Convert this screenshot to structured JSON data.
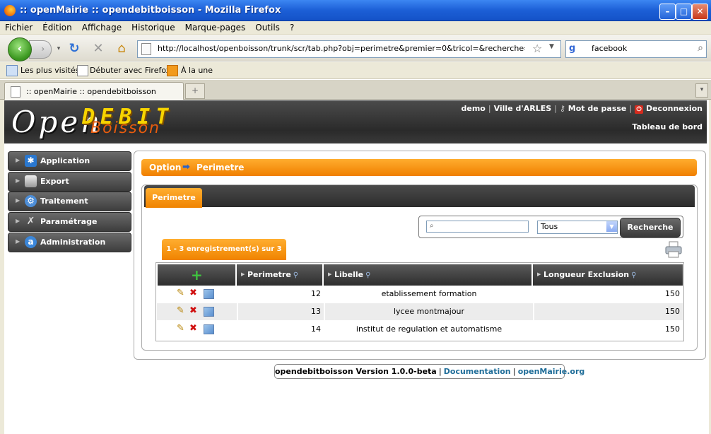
{
  "window": {
    "title": ":: openMairie :: opendebitboisson - Mozilla Firefox"
  },
  "menubar": {
    "items": [
      "Fichier",
      "Édition",
      "Affichage",
      "Historique",
      "Marque-pages",
      "Outils",
      "?"
    ]
  },
  "navbar": {
    "url": "http://localhost/openboisson/trunk/scr/tab.php?obj=perimetre&premier=0&tricol=&recherche=&selectioncol=",
    "search_value": "facebook"
  },
  "bookmarks": {
    "items": [
      "Les plus visités",
      "Débuter avec Firefox",
      "À la une"
    ]
  },
  "tabs": {
    "active_label": ":: openMairie :: opendebitboisson"
  },
  "app": {
    "logo": {
      "open": "Open",
      "debit": "DEBIT",
      "boisson": "Boisson"
    },
    "user": "demo",
    "city": "Ville d'ARLES",
    "password_link": "Mot de passe",
    "logout_link": "Deconnexion",
    "dashboard_link": "Tableau de bord"
  },
  "sidebar": {
    "items": [
      {
        "label": "Application",
        "icon": "application-icon"
      },
      {
        "label": "Export",
        "icon": "printer-icon"
      },
      {
        "label": "Traitement",
        "icon": "gear-icon"
      },
      {
        "label": "Paramétrage",
        "icon": "tools-icon"
      },
      {
        "label": "Administration",
        "icon": "admin-icon"
      }
    ]
  },
  "breadcrumb": {
    "section": "Option",
    "arrow_icon": "arrow-right-icon",
    "current": "Perimetre"
  },
  "main": {
    "tab_label": "Perimetre",
    "search": {
      "value": "",
      "scope_selected": "Tous",
      "button_label": "Recherche"
    },
    "count_label": "1 - 3 enregistrement(s) sur 3"
  },
  "table": {
    "columns": [
      "Perimetre",
      "Libelle",
      "Longueur Exclusion"
    ],
    "rows": [
      {
        "perimetre": "12",
        "libelle": "etablissement formation",
        "longueur": "150"
      },
      {
        "perimetre": "13",
        "libelle": "lycee montmajour",
        "longueur": "150"
      },
      {
        "perimetre": "14",
        "libelle": "institut de regulation et automatisme",
        "longueur": "150"
      }
    ]
  },
  "footer": {
    "version": "opendebitboisson Version 1.0.0-beta",
    "documentation": "Documentation",
    "site": "openMairie.org"
  },
  "colors": {
    "accent_orange": "#f08300",
    "header_dark": "#2a2a2a",
    "titlebar_blue": "#1c5fd6"
  }
}
